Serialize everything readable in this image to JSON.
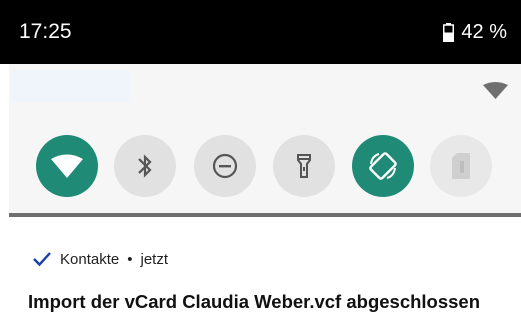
{
  "status_bar": {
    "time": "17:25",
    "battery_icon": "battery-icon",
    "battery_level": "42 %"
  },
  "quick_settings": {
    "signal_icon": "wifi-signal-icon",
    "tiles": [
      {
        "icon": "wifi-icon",
        "state": "on"
      },
      {
        "icon": "bluetooth-icon",
        "state": "off"
      },
      {
        "icon": "do-not-disturb-icon",
        "state": "off"
      },
      {
        "icon": "flashlight-icon",
        "state": "off"
      },
      {
        "icon": "auto-rotate-icon",
        "state": "on"
      },
      {
        "icon": "sim-card-icon",
        "state": "unavailable"
      }
    ],
    "colors": {
      "active_tile": "#1f8a76",
      "inactive_tile": "#e1e1e1",
      "panel_background": "#f6f6f6"
    }
  },
  "notification": {
    "app_icon": "check-icon",
    "app_name": "Kontakte",
    "separator": "•",
    "time": "jetzt",
    "title": "Import der vCard Claudia Weber.vcf abgeschlossen",
    "accent_color": "#1a3fa8"
  }
}
